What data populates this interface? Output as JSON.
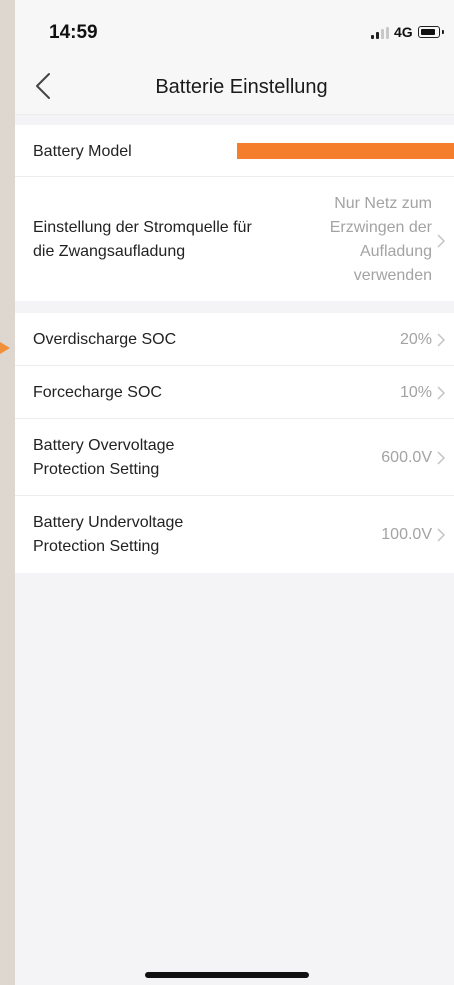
{
  "status_bar": {
    "time": "14:59",
    "network": "4G"
  },
  "header": {
    "title": "Batterie Einstellung"
  },
  "battery_model": {
    "label": "Battery Model"
  },
  "power_source": {
    "label_line1": "Einstellung der Stromquelle für",
    "label_line2": "die Zwangsaufladung",
    "value_lines": [
      "Nur Netz zum",
      "Erzwingen der",
      "Aufladung",
      "verwenden"
    ]
  },
  "settings": [
    {
      "label_lines": [
        "Overdischarge SOC"
      ],
      "value": "20%"
    },
    {
      "label_lines": [
        "Forcecharge SOC"
      ],
      "value": "10%"
    },
    {
      "label_lines": [
        "Battery Overvoltage",
        "Protection Setting"
      ],
      "value": "600.0V"
    },
    {
      "label_lines": [
        "Battery Undervoltage",
        "Protection Setting"
      ],
      "value": "100.0V"
    }
  ],
  "colors": {
    "accent": "#f47e2c",
    "value_text": "#a3a3a3",
    "background": "#f4f4f6"
  }
}
